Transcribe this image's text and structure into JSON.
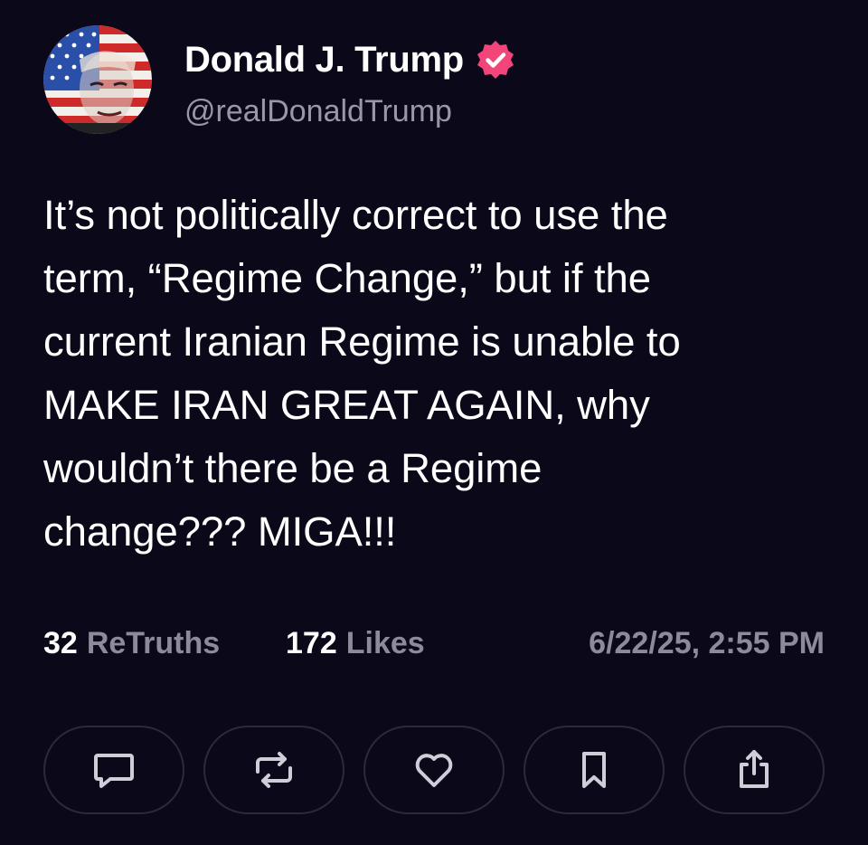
{
  "author": {
    "display_name": "Donald J. Trump",
    "handle": "@realDonaldTrump",
    "avatar_icon": "flag-portrait-avatar",
    "verified_icon": "verified-badge-icon",
    "verified_color": "#f2457a"
  },
  "post": {
    "text": "It’s not politically correct to use the\nterm, “Regime Change,” but if the\ncurrent Iranian Regime is unable to\nMAKE IRAN GREAT AGAIN, why\nwouldn’t there be a Regime\nchange??? MIGA!!!"
  },
  "stats": {
    "retruths_count": "32",
    "retruths_label": "ReTruths",
    "likes_count": "172",
    "likes_label": "Likes",
    "timestamp": "6/22/25, 2:55 PM"
  },
  "actions": [
    {
      "name": "reply",
      "icon": "comment-icon"
    },
    {
      "name": "retruth",
      "icon": "repost-icon"
    },
    {
      "name": "like",
      "icon": "heart-icon"
    },
    {
      "name": "bookmark",
      "icon": "bookmark-icon"
    },
    {
      "name": "share",
      "icon": "share-icon"
    }
  ],
  "colors": {
    "background": "#0b0819",
    "text_primary": "#ffffff",
    "text_secondary": "#8c8a9b",
    "button_border": "#2b2a3e"
  }
}
